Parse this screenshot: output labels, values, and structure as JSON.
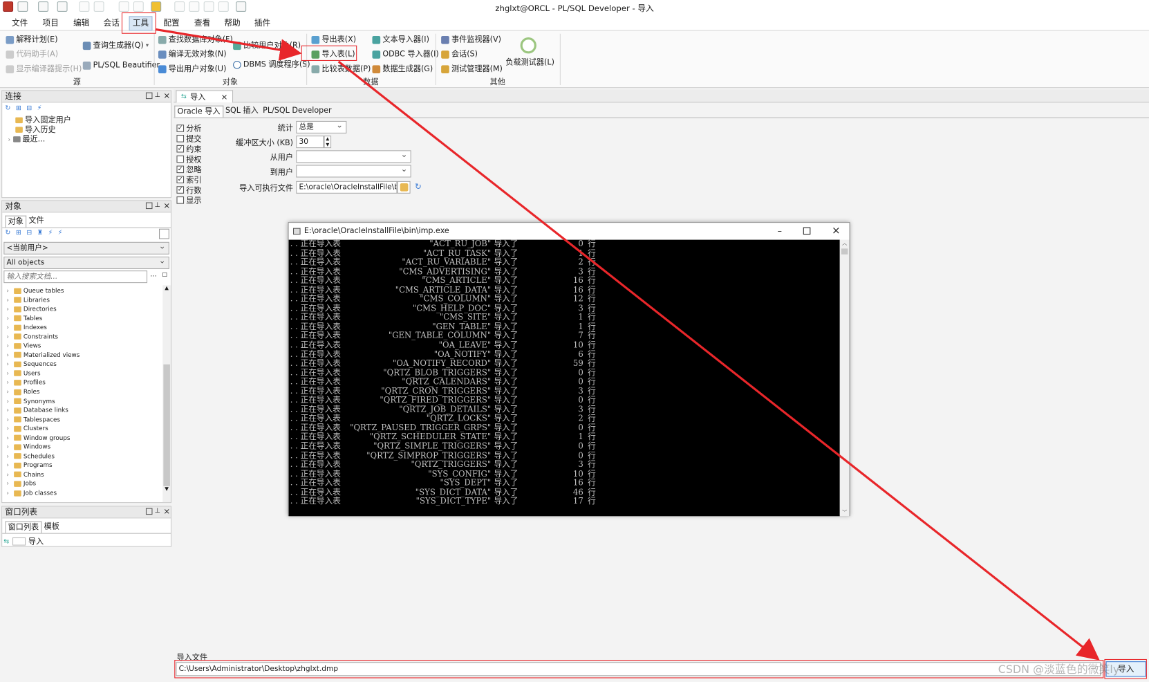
{
  "window": {
    "title": "zhglxt@ORCL - PL/SQL Developer - 导入"
  },
  "menu": [
    "文件",
    "项目",
    "编辑",
    "会话",
    "工具",
    "配置",
    "查看",
    "帮助",
    "插件"
  ],
  "ribbon": {
    "source": {
      "items": [
        "解释计划(E)",
        "代码助手(A)",
        "显示编译器提示(H)",
        "查询生成器(Q)",
        "PL/SQL Beautifier"
      ],
      "group": "源"
    },
    "objects": {
      "items": [
        "查找数据库对象(F)",
        "编译无效对象(N)",
        "导出用户对象(U)",
        "比较用户对象(R)",
        "DBMS 调度程序(S)"
      ],
      "group": "对象"
    },
    "data": {
      "items": [
        "导出表(X)",
        "导入表(L)",
        "比较表数据(P)",
        "文本导入器(I)",
        "ODBC 导入器(I)",
        "数据生成器(G)"
      ],
      "group": "数据"
    },
    "other": {
      "items": [
        "事件监视器(V)",
        "会话(S)",
        "测试管理器(M)",
        "负载测试器(L)"
      ],
      "group": "其他"
    }
  },
  "connection_panel": {
    "title": "连接",
    "items": [
      "导入固定用户",
      "导入历史",
      "最近..."
    ]
  },
  "objects_panel": {
    "title": "对象",
    "tabs": [
      "对象",
      "文件"
    ],
    "user_select": "<当前用户>",
    "filter_select": "All objects",
    "search_placeholder": "输入搜索文档...",
    "items": [
      "Queue tables",
      "Libraries",
      "Directories",
      "Tables",
      "Indexes",
      "Constraints",
      "Views",
      "Materialized views",
      "Sequences",
      "Users",
      "Profiles",
      "Roles",
      "Synonyms",
      "Database links",
      "Tablespaces",
      "Clusters",
      "Window groups",
      "Windows",
      "Schedules",
      "Programs",
      "Chains",
      "Jobs",
      "Job classes"
    ]
  },
  "window_list_panel": {
    "title": "窗口列表",
    "tabs": [
      "窗口列表",
      "模板"
    ],
    "item": "导入"
  },
  "editor": {
    "tab_label": "导入",
    "subtabs": [
      "Oracle 导入",
      "SQL 插入",
      "PL/SQL Developer"
    ],
    "options": [
      {
        "label": "分析",
        "checked": true
      },
      {
        "label": "提交",
        "checked": false
      },
      {
        "label": "约束",
        "checked": true
      },
      {
        "label": "授权",
        "checked": false
      },
      {
        "label": "忽略",
        "checked": true
      },
      {
        "label": "索引",
        "checked": true
      },
      {
        "label": "行数",
        "checked": true
      },
      {
        "label": "显示",
        "checked": false
      }
    ],
    "stats_label": "统计",
    "stats_value": "总是",
    "buffer_label": "缓冲区大小 (KB)",
    "buffer_value": "30",
    "from_user_label": "从用户",
    "to_user_label": "到用户",
    "exe_label": "导入可执行文件",
    "exe_value": "E:\\oracle\\OracleInstallFile\\bin\\imp.exe",
    "import_file_label": "导入文件",
    "import_file_value": "C:\\Users\\Administrator\\Desktop\\zhglxt.dmp",
    "import_button": "导入"
  },
  "console": {
    "title": "E:\\oracle\\OracleInstallFile\\bin\\imp.exe",
    "prefix": ". .  正在导入表",
    "suffix": "导入了",
    "unit": "行",
    "rows": [
      {
        "table": "\"ACT_RU_JOB\"",
        "count": "0"
      },
      {
        "table": "\"ACT_RU_TASK\"",
        "count": "1"
      },
      {
        "table": "\"ACT_RU_VARIABLE\"",
        "count": "2"
      },
      {
        "table": "\"CMS_ADVERTISING\"",
        "count": "3"
      },
      {
        "table": "\"CMS_ARTICLE\"",
        "count": "16"
      },
      {
        "table": "\"CMS_ARTICLE_DATA\"",
        "count": "16"
      },
      {
        "table": "\"CMS_COLUMN\"",
        "count": "12"
      },
      {
        "table": "\"CMS_HELP_DOC\"",
        "count": "3"
      },
      {
        "table": "\"CMS_SITE\"",
        "count": "1"
      },
      {
        "table": "\"GEN_TABLE\"",
        "count": "1"
      },
      {
        "table": "\"GEN_TABLE_COLUMN\"",
        "count": "7"
      },
      {
        "table": "\"OA_LEAVE\"",
        "count": "10"
      },
      {
        "table": "\"OA_NOTIFY\"",
        "count": "6"
      },
      {
        "table": "\"OA_NOTIFY_RECORD\"",
        "count": "59"
      },
      {
        "table": "\"QRTZ_BLOB_TRIGGERS\"",
        "count": "0"
      },
      {
        "table": "\"QRTZ_CALENDARS\"",
        "count": "0"
      },
      {
        "table": "\"QRTZ_CRON_TRIGGERS\"",
        "count": "3"
      },
      {
        "table": "\"QRTZ_FIRED_TRIGGERS\"",
        "count": "0"
      },
      {
        "table": "\"QRTZ_JOB_DETAILS\"",
        "count": "3"
      },
      {
        "table": "\"QRTZ_LOCKS\"",
        "count": "2"
      },
      {
        "table": "\"QRTZ_PAUSED_TRIGGER_GRPS\"",
        "count": "0"
      },
      {
        "table": "\"QRTZ_SCHEDULER_STATE\"",
        "count": "1"
      },
      {
        "table": "\"QRTZ_SIMPLE_TRIGGERS\"",
        "count": "0"
      },
      {
        "table": "\"QRTZ_SIMPROP_TRIGGERS\"",
        "count": "0"
      },
      {
        "table": "\"QRTZ_TRIGGERS\"",
        "count": "3"
      },
      {
        "table": "\"SYS_CONFIG\"",
        "count": "10"
      },
      {
        "table": "\"SYS_DEPT\"",
        "count": "16"
      },
      {
        "table": "\"SYS_DICT_DATA\"",
        "count": "46"
      },
      {
        "table": "\"SYS_DICT_TYPE\"",
        "count": "17"
      }
    ]
  },
  "watermark": "CSDN @淡蓝色的微笑ly",
  "colors": {
    "annotation_red": "#e8262a",
    "selection_blue": "#d9e6f5",
    "console_bg": "#000000"
  }
}
